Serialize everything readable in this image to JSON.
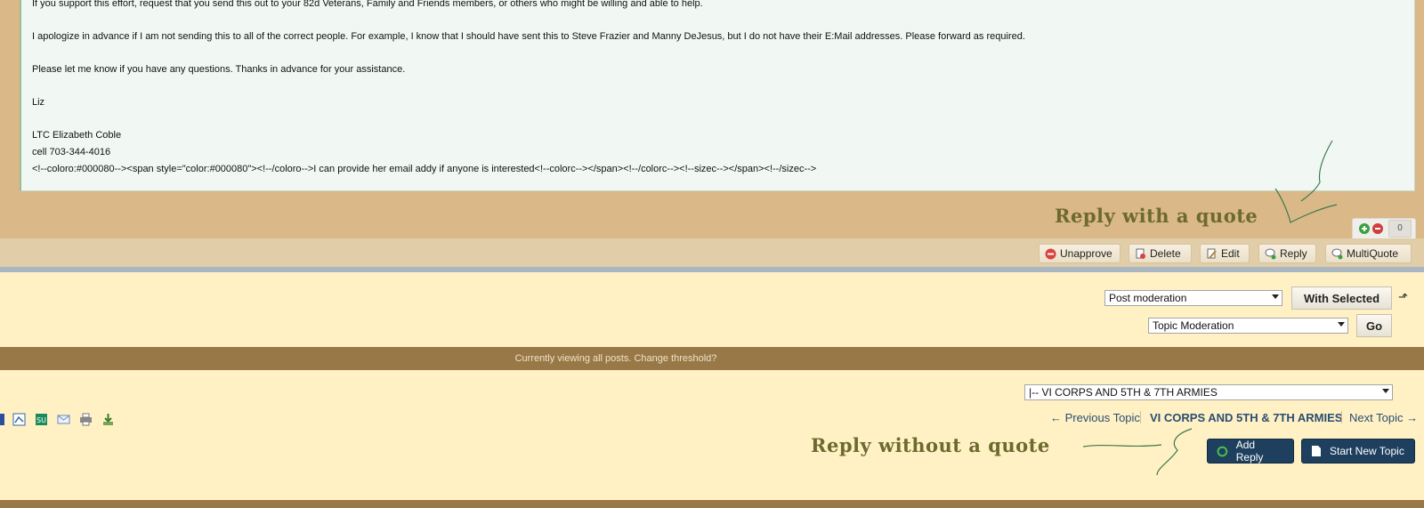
{
  "post": {
    "lines": [
      "If you support this effort, request that you send this out to your 82d Veterans, Family and Friends members, or others who might be willing and able to help.",
      "I apologize in advance if I am not sending this to all of the correct people. For example, I know that I should have sent this to Steve Frazier and Manny DeJesus, but I do not have their E:Mail addresses. Please forward as required.",
      "Please let me know if you have any questions. Thanks in advance for your assistance.",
      "Liz",
      "LTC Elizabeth Coble",
      "cell 703-344-4016",
      "<!--coloro:#000080--><span style=\"color:#000080\"><!--/coloro-->I can provide her email addy if anyone is interested<!--colorc--></span><!--/colorc--><!--sizec--></span><!--/sizec-->"
    ]
  },
  "annotations": {
    "reply_with_quote": "Reply with a quote",
    "reply_without_quote": "Reply without a quote"
  },
  "reputation": {
    "count": "0"
  },
  "post_buttons": {
    "unapprove": "Unapprove",
    "delete": "Delete",
    "edit": "Edit",
    "reply": "Reply",
    "multiquote": "MultiQuote"
  },
  "moderation": {
    "post_select": "Post moderation",
    "with_selected": "With Selected",
    "topic_select": "Topic Moderation",
    "go": "Go"
  },
  "threshold": {
    "text": "Currently viewing all posts. Change threshold?"
  },
  "forum_jump": {
    "selected": "|-- VI CORPS AND 5TH & 7TH ARMIES"
  },
  "topic_nav": {
    "previous": "← Previous Topic",
    "current": "VI CORPS AND 5TH & 7TH ARMIES",
    "next": "Next Topic →"
  },
  "actions": {
    "add_reply": "Add Reply",
    "start_new_topic": "Start New Topic"
  },
  "colors": {
    "post_bg": "#f1f8f4",
    "header_tan": "#dab888",
    "page_bg": "#fff1c4",
    "dark_button": "#1e3f5e",
    "link": "#2b4d73"
  }
}
